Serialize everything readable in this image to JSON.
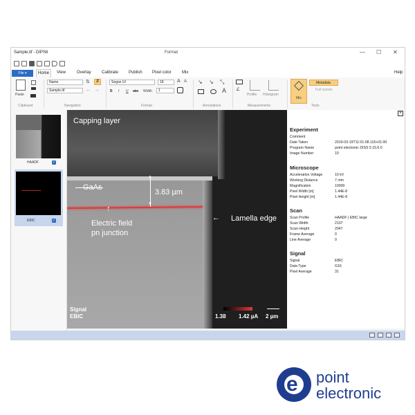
{
  "window": {
    "title": "Sample.tif - DIPS6",
    "context_tab": "Format",
    "help": "Help"
  },
  "tabs": {
    "file": "File ▾",
    "items": [
      "Home",
      "View",
      "Overlay",
      "Calibrate",
      "Publish",
      "Pixel color",
      "Mix"
    ]
  },
  "ribbon": {
    "clipboard": {
      "paste": "Paste",
      "group": "Clipboard"
    },
    "navigation": {
      "sort_field": "Name",
      "file_field": "Sample.tif",
      "group": "Navigation"
    },
    "format": {
      "font": "Segoe UI",
      "size": "18",
      "width_label": "Width",
      "width_value": "1",
      "group": "Format",
      "bold": "B",
      "italic": "I",
      "underline": "U",
      "strike": "abc"
    },
    "annotations": {
      "group": "Annotations"
    },
    "measurements": {
      "profile": "Profile",
      "histogram": "Histogram",
      "group": "Measurements"
    },
    "tools": {
      "mix": "Mix",
      "metadata": "Metadata",
      "fullscreen": "Full screen",
      "group": "Tools"
    }
  },
  "thumbnails": [
    {
      "label": "HAADF",
      "checked": true
    },
    {
      "label": "EBIC",
      "checked": true
    }
  ],
  "image": {
    "capping_layer": "Capping layer",
    "gaas": "GaAs",
    "thickness": "3.83 µm",
    "electric_field": "Electric field",
    "pn_junction": "pn junction",
    "lamella_edge": "Lamella edge",
    "signal_label": "Signal",
    "signal_value": "EBIC",
    "colorbar_min": "1.38",
    "colorbar_max": "1.42 µA",
    "scalebar": "2 µm"
  },
  "metadata": {
    "experiment": {
      "heading": "Experiment",
      "rows": [
        [
          "Comment",
          ""
        ],
        [
          "Date Taken",
          "2019-03-19T11:01:08.116+01:00"
        ],
        [
          "Program Name",
          "point electronic DISS 5.15.6.0"
        ],
        [
          "Image Number",
          "10"
        ]
      ]
    },
    "microscope": {
      "heading": "Microscope",
      "rows": [
        [
          "Acceleration Voltage",
          "10 kV"
        ],
        [
          "Working Distance",
          "7 mm"
        ],
        [
          "Magnification",
          "10000"
        ],
        [
          "Pixel Width [m]",
          "1.44E-8"
        ],
        [
          "Pixel Height [m]",
          "1.44E-8"
        ]
      ]
    },
    "scan": {
      "heading": "Scan",
      "rows": [
        [
          "Scan Profile",
          "HAADF | EBIC large"
        ],
        [
          "Scan Width",
          "2107"
        ],
        [
          "Scan Height",
          "2047"
        ],
        [
          "Frame Average",
          "0"
        ],
        [
          "Line Average",
          "0"
        ]
      ]
    },
    "signal": {
      "heading": "Signal",
      "rows": [
        [
          "Signal",
          "EBIC"
        ],
        [
          "Data Type",
          "G16"
        ],
        [
          "Pixel Average",
          "31"
        ]
      ]
    }
  },
  "logo": {
    "line1": "point",
    "line2": "electronic"
  },
  "colors": {
    "accent": "#2b6cc4",
    "highlight": "#f6cf80",
    "status": "#c7d6ec",
    "logo": "#1f3d8f",
    "junction": "#e0393b"
  }
}
